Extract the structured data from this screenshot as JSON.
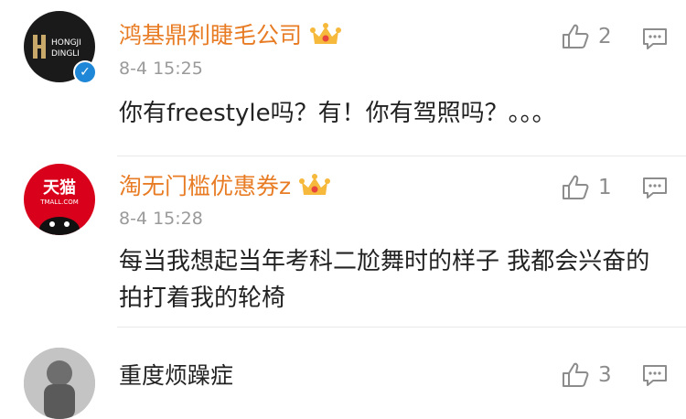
{
  "comments": [
    {
      "username": "鸿基鼎利睫毛公司",
      "time": "8-4 15:25",
      "text": "你有freestyle吗？有！你有驾照吗？。。。",
      "likes": "2",
      "avatar": {
        "line1": "HONGJI",
        "line2": "DINGLI"
      }
    },
    {
      "username": "淘无门槛优惠券z",
      "time": "8-4 15:28",
      "text": "每当我想起当年考科二尬舞时的样子 我都会兴奋的拍打着我的轮椅",
      "likes": "1",
      "avatar": {
        "line1": "天猫",
        "line2": "TMALL.COM"
      }
    },
    {
      "username": "重度烦躁症",
      "likes": "3"
    }
  ],
  "colors": {
    "username": "#e87c25",
    "verified": "#1e87d7",
    "tmall_red": "#d9001b"
  },
  "icons": {
    "like": "thumbs-up-icon",
    "reply": "comment-icon",
    "vip": "crown-icon"
  }
}
